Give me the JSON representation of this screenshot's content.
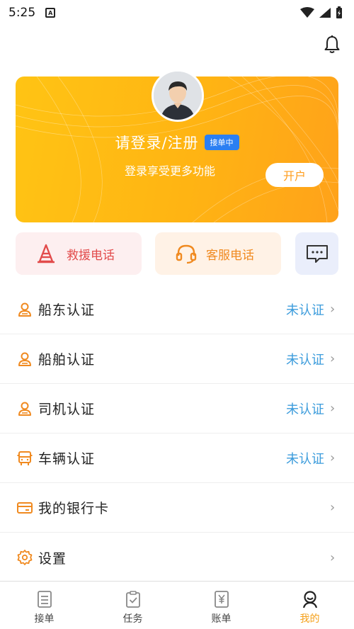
{
  "status_bar": {
    "time": "5:25",
    "notification_glyph": "A"
  },
  "colors": {
    "accent": "#ffb413",
    "link_status": "#3c9cdc",
    "rescue": "#e24b4b",
    "service": "#f08a20",
    "tab_active": "#f5a019"
  },
  "profile_card": {
    "login_title": "请登录/注册",
    "status_badge": "接单中",
    "subtitle": "登录享受更多功能",
    "open_account_button": "开户"
  },
  "quick_actions": {
    "rescue": "救援电话",
    "service": "客服电话",
    "message_icon": "chat-bubble-icon"
  },
  "menu": {
    "items": [
      {
        "label": "船东认证",
        "status": "未认证",
        "icon": "user-badge-icon"
      },
      {
        "label": "船舶认证",
        "status": "未认证",
        "icon": "user-badge-icon"
      },
      {
        "label": "司机认证",
        "status": "未认证",
        "icon": "user-badge-icon"
      },
      {
        "label": "车辆认证",
        "status": "未认证",
        "icon": "truck-icon"
      },
      {
        "label": "我的银行卡",
        "status": "",
        "icon": "card-icon"
      },
      {
        "label": "设置",
        "status": "",
        "icon": "gear-icon"
      }
    ]
  },
  "tabs": [
    {
      "label": "接单",
      "icon": "document-icon",
      "active": false
    },
    {
      "label": "任务",
      "icon": "clipboard-check-icon",
      "active": false
    },
    {
      "label": "账单",
      "icon": "yen-bill-icon",
      "active": false
    },
    {
      "label": "我的",
      "icon": "person-icon",
      "active": true
    }
  ]
}
